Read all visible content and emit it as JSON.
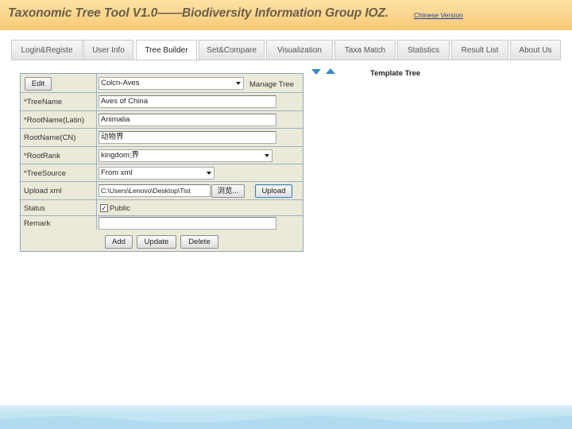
{
  "header": {
    "title": "Taxonomic Tree Tool V1.0——Biodiversity Information Group IOZ.",
    "language_link": "Chinese Version"
  },
  "tabs": [
    {
      "label": "Login&Registe"
    },
    {
      "label": "User Info"
    },
    {
      "label": "Tree Builder",
      "active": true
    },
    {
      "label": "Set&Compare"
    },
    {
      "label": "Visualization"
    },
    {
      "label": "Taxa Match"
    },
    {
      "label": "Statistics"
    },
    {
      "label": "Result List"
    },
    {
      "label": "About Us"
    }
  ],
  "form": {
    "edit_button": "Edit",
    "tree_select": "Colcn-Aves",
    "manage_tree_label": "Manage Tree",
    "tree_name_label": "*TreeName",
    "tree_name_value": "Aves of China",
    "root_name_latin_label": "*RootName(Latin)",
    "root_name_latin_value": "Animalia",
    "root_name_cn_label": "RootName(CN)",
    "root_name_cn_value": "动物界",
    "root_rank_label": "*RootRank",
    "root_rank_value": "kingdom;界",
    "tree_source_label": "*TreeSource",
    "tree_source_value": "From xml",
    "upload_xml_label": "Upload xml",
    "upload_path_value": "C:\\Users\\Lenovo\\Desktop\\Tist",
    "browse_button": "浏览...",
    "upload_button": "Upload",
    "status_label": "Status",
    "public_checked": true,
    "public_label": "Public",
    "remark_label": "Remark",
    "remark_value": "",
    "add_button": "Add",
    "update_button": "Update",
    "delete_button": "Delete"
  },
  "template_tree": {
    "title": "Template Tree"
  },
  "colors": {
    "header_bg": "#fbd48a",
    "title_color": "#6b5d4a",
    "link_color": "#1a3fa8",
    "form_bg": "#ebe9d8",
    "arrow_color": "#3a87c8"
  }
}
